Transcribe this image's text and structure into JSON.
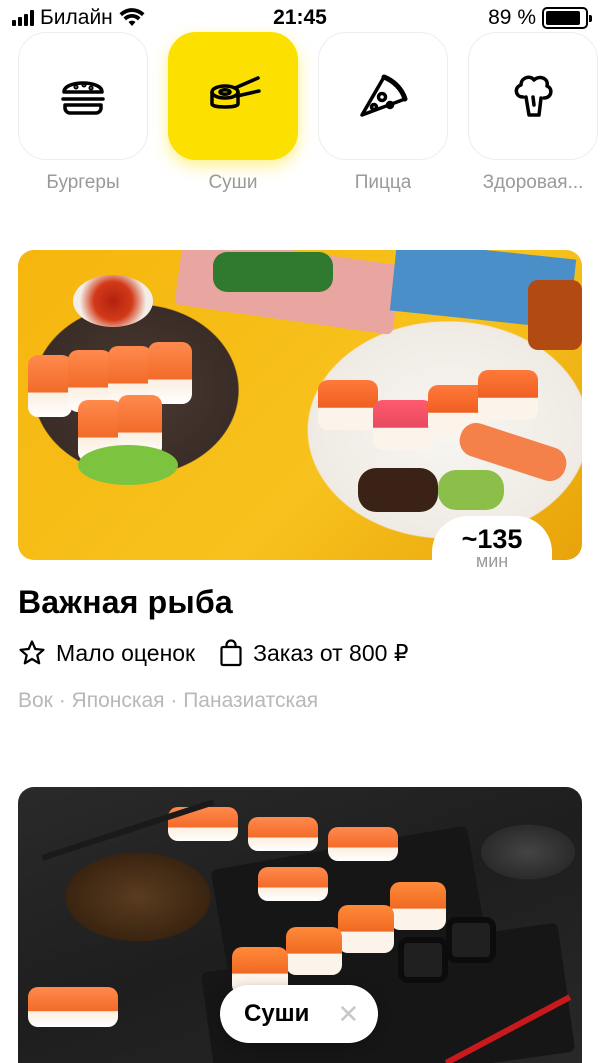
{
  "status_bar": {
    "carrier": "Билайн",
    "time": "21:45",
    "battery": "89 %",
    "battery_level_percent": 89
  },
  "categories": [
    {
      "label": "Бургеры",
      "icon": "burger-icon",
      "active": false
    },
    {
      "label": "Суши",
      "icon": "sushi-roll-icon",
      "active": true
    },
    {
      "label": "Пицца",
      "icon": "pizza-icon",
      "active": false
    },
    {
      "label": "Здоровая...",
      "icon": "broccoli-icon",
      "active": false
    }
  ],
  "restaurants": [
    {
      "name": "Важная рыба",
      "eta": "~135",
      "eta_unit": "мин",
      "rating": "Мало оценок",
      "min_order": "Заказ от 800 ₽",
      "tags": "Вок · Японская · Паназиатская"
    }
  ],
  "filter_chip": {
    "label": "Суши",
    "close_icon": "close-icon"
  },
  "colors": {
    "accent_yellow": "#fce000",
    "muted_text": "#9a9a9a"
  }
}
